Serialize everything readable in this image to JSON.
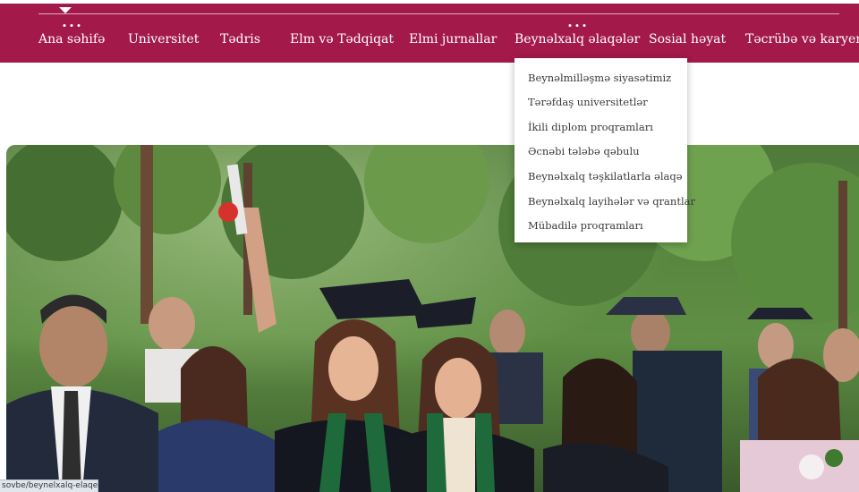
{
  "nav": {
    "items": [
      {
        "label": "Ana səhifə",
        "active": true
      },
      {
        "label": "Universitet"
      },
      {
        "label": "Tədris"
      },
      {
        "label": "Elm və Tədqiqat"
      },
      {
        "label": "Elmi jurnallar"
      },
      {
        "label": "Beynəlxalq əlaqələr",
        "hovered": true
      },
      {
        "label": "Sosial həyat"
      },
      {
        "label": "Təcrübə və karyera"
      }
    ]
  },
  "dropdown": {
    "items": [
      "Beynəlmilləşmə siyasətimiz",
      "Tərəfdaş universitetlər",
      "İkili diplom proqramları",
      "Əcnəbi tələbə qəbulu",
      "Beynəlxalq təşkilatlarla əlaqə",
      "Beynəlxalq layihələr və qrantlar",
      "Mübadilə proqramları"
    ]
  },
  "status_bar": {
    "url": "sovbe/beynelxalq-elaqeler"
  },
  "colors": {
    "brand": "#a3194a",
    "foliage": "#3c6a2c",
    "gown": "#1f2430",
    "stole": "#1f6a3a"
  }
}
